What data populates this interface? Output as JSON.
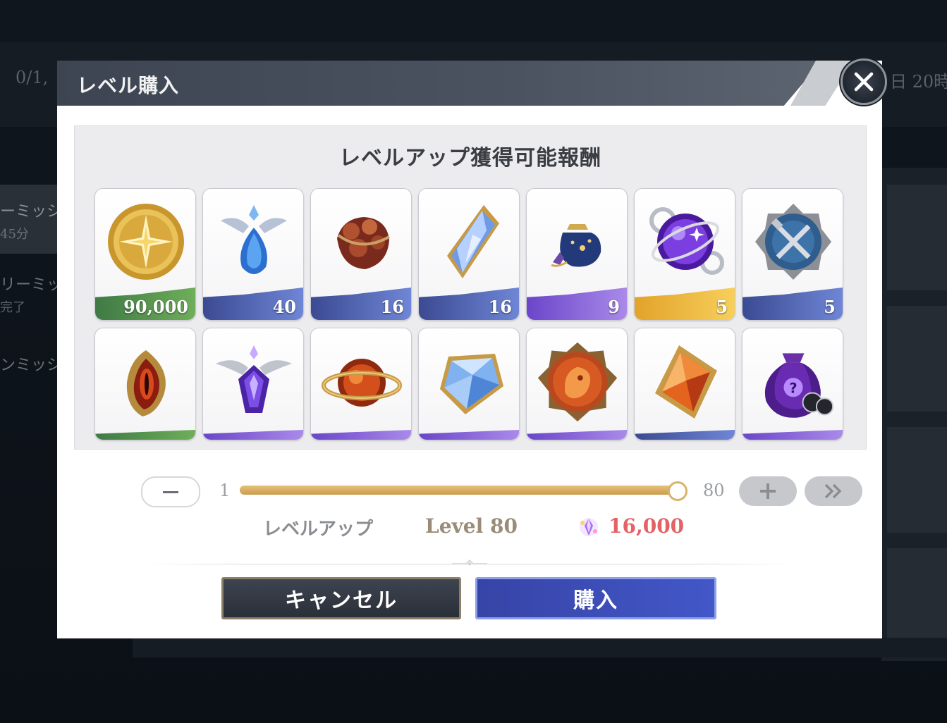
{
  "background": {
    "top_left_text": "0/1,",
    "top_right_text": "日 20時",
    "side_items": [
      "ーミッシ",
      "45分",
      "リーミッ",
      "完了",
      "ンミッシ"
    ]
  },
  "modal": {
    "title": "レベル購入",
    "close_icon": "close-icon"
  },
  "rewards": {
    "title": "レベルアップ獲得可能報酬",
    "items": [
      {
        "icon": "gold-coin-icon",
        "quantity": "90,000",
        "rarity": "green"
      },
      {
        "icon": "blue-winged-gem-icon",
        "quantity": "40",
        "rarity": "blue"
      },
      {
        "icon": "ore-chunk-icon",
        "quantity": "16",
        "rarity": "blue"
      },
      {
        "icon": "blue-crystal-icon",
        "quantity": "16",
        "rarity": "blue"
      },
      {
        "icon": "blue-pouch-icon",
        "quantity": "9",
        "rarity": "purple"
      },
      {
        "icon": "purple-orb-icon",
        "quantity": "5",
        "rarity": "gold"
      },
      {
        "icon": "crossed-weapons-emblem-icon",
        "quantity": "5",
        "rarity": "blue"
      },
      {
        "icon": "dragon-eye-icon",
        "quantity": "",
        "rarity": "green"
      },
      {
        "icon": "purple-winged-gem-icon",
        "quantity": "",
        "rarity": "purple"
      },
      {
        "icon": "fire-planet-icon",
        "quantity": "",
        "rarity": "purple"
      },
      {
        "icon": "blue-cube-crystal-icon",
        "quantity": "",
        "rarity": "purple"
      },
      {
        "icon": "lion-emblem-icon",
        "quantity": "",
        "rarity": "purple"
      },
      {
        "icon": "fire-diamond-icon",
        "quantity": "",
        "rarity": "blue"
      },
      {
        "icon": "mystery-bag-icon",
        "quantity": "",
        "rarity": "purple"
      }
    ]
  },
  "slider": {
    "min": "1",
    "max": "80",
    "value": 80,
    "min_value": 1,
    "max_value": 80
  },
  "summary": {
    "label": "レベルアップ",
    "level": "Level 80",
    "cost": "16,000",
    "cost_icon": "crystal-currency-icon"
  },
  "buttons": {
    "cancel": "キャンセル",
    "buy": "購入"
  },
  "colors": {
    "accent_blue": "#4257c8",
    "cost_red": "#e46165",
    "slider_gold": "#d9b36b"
  }
}
